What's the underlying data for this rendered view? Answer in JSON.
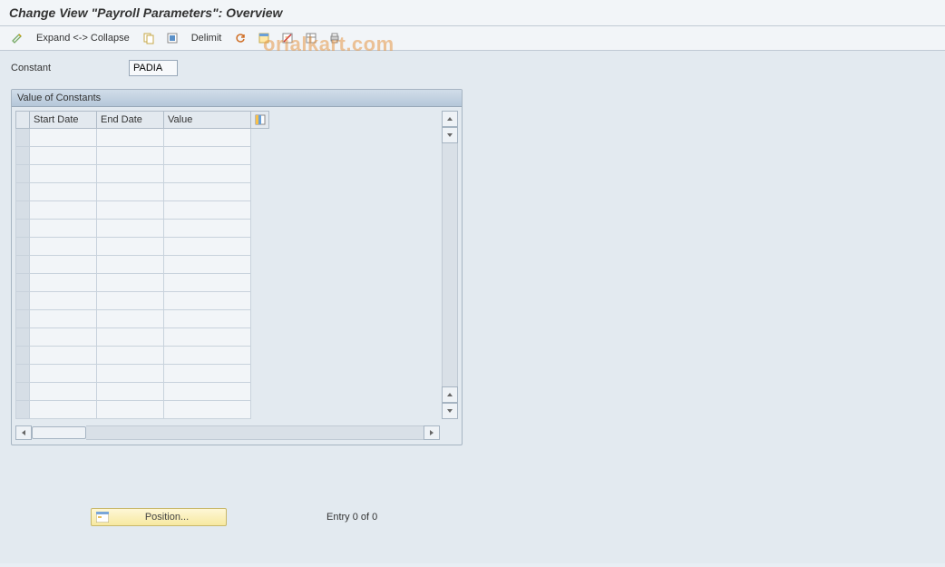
{
  "header": {
    "title": "Change View \"Payroll Parameters\": Overview"
  },
  "toolbar": {
    "expand_collapse": "Expand <-> Collapse",
    "delimit": "Delimit"
  },
  "constant_field": {
    "label": "Constant",
    "value": "PADIA"
  },
  "panel": {
    "title": "Value of Constants",
    "columns": {
      "start_date": "Start Date",
      "end_date": "End Date",
      "value": "Value"
    },
    "row_count": 16
  },
  "footer": {
    "position_label": "Position...",
    "entry_text": "Entry 0 of 0"
  },
  "watermark": "orialkart.com"
}
